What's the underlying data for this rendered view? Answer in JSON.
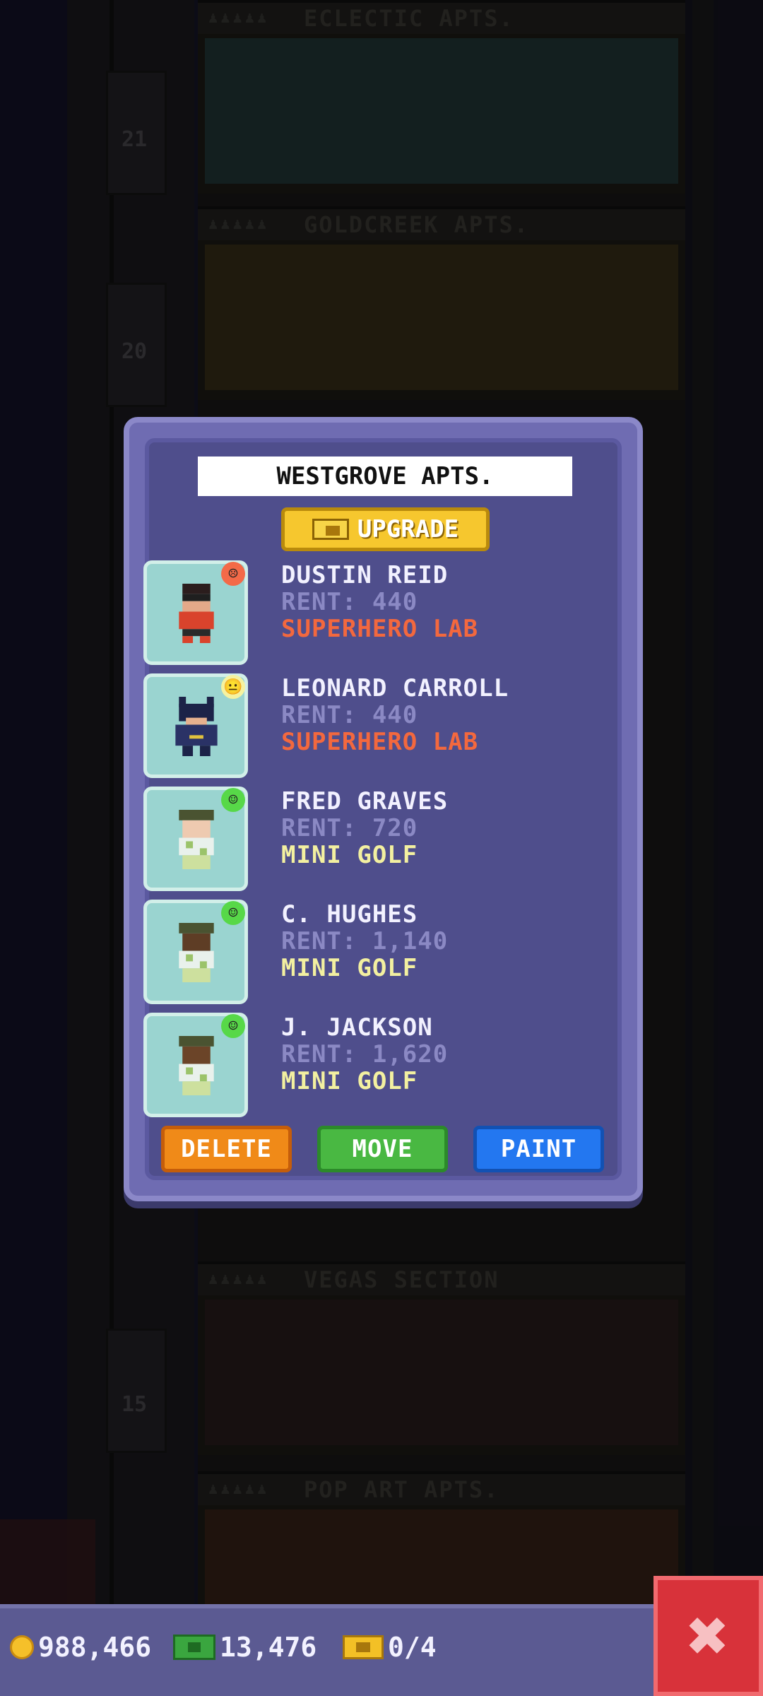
{
  "background": {
    "floors": [
      {
        "label": "ECLECTIC APTS.",
        "number": "21"
      },
      {
        "label": "GOLDCREEK APTS.",
        "number": "20"
      },
      {
        "label": "VEGAS SECTION",
        "number": "15"
      },
      {
        "label": "POP ART APTS.",
        "number": ""
      }
    ]
  },
  "dialog": {
    "name_value": "WESTGROVE APTS.",
    "upgrade_label": "UPGRADE",
    "residents": [
      {
        "name": "DUSTIN REID",
        "rent": "RENT: 440",
        "job": "SUPERHERO LAB",
        "mood": "sad",
        "type": "lab"
      },
      {
        "name": "LEONARD CARROLL",
        "rent": "RENT: 440",
        "job": "SUPERHERO LAB",
        "mood": "meh",
        "type": "lab"
      },
      {
        "name": "FRED GRAVES",
        "rent": "RENT: 720",
        "job": "MINI GOLF",
        "mood": "happy",
        "type": "golf"
      },
      {
        "name": "C. HUGHES",
        "rent": "RENT: 1,140",
        "job": "MINI GOLF",
        "mood": "happy",
        "type": "golf"
      },
      {
        "name": "J. JACKSON",
        "rent": "RENT: 1,620",
        "job": "MINI GOLF",
        "mood": "happy",
        "type": "golf"
      }
    ],
    "buttons": {
      "delete": "DELETE",
      "move": "MOVE",
      "paint": "PAINT"
    }
  },
  "status_bar": {
    "coins": "988,466",
    "bux": "13,476",
    "tickets": "0/4"
  },
  "colors": {
    "dialog_bg": "#4f4e8c",
    "lab_job": "#f3683e",
    "golf_job": "#f3f0a0",
    "delete": "#f08a18",
    "move": "#49b842",
    "paint": "#2377f0",
    "close": "#d8323a"
  }
}
